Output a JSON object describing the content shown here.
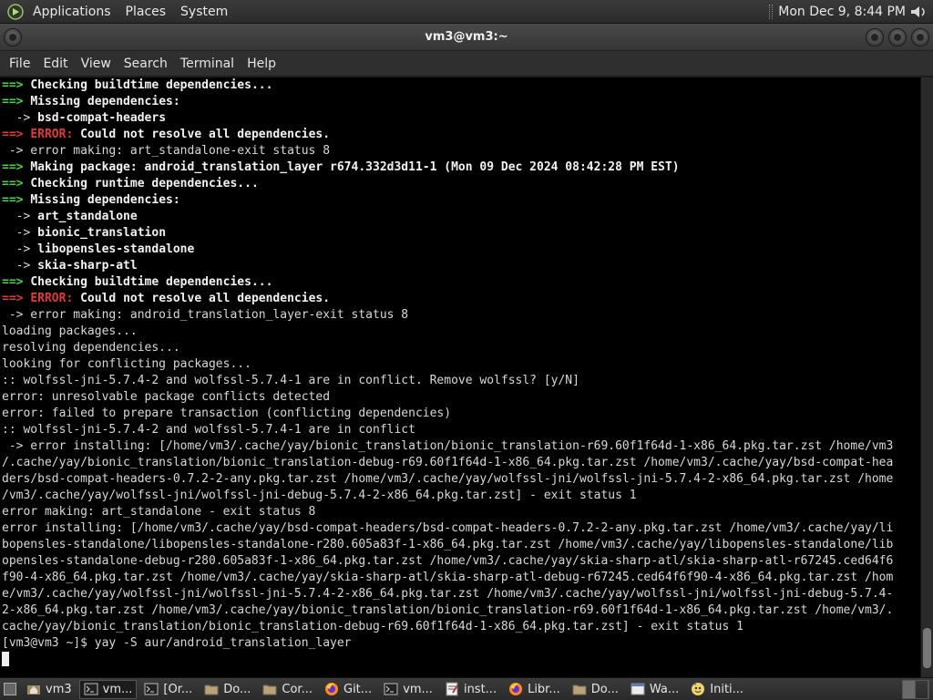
{
  "top_panel": {
    "menus": [
      "Applications",
      "Places",
      "System"
    ],
    "clock": "Mon Dec 9,  8:44 PM"
  },
  "window": {
    "title": "vm3@vm3:~"
  },
  "menubar": [
    "File",
    "Edit",
    "View",
    "Search",
    "Terminal",
    "Help"
  ],
  "terminal": {
    "lines": [
      [
        {
          "t": "==> ",
          "c": "g"
        },
        {
          "t": "Checking buildtime dependencies...",
          "c": "b"
        }
      ],
      [
        {
          "t": "==> ",
          "c": "g"
        },
        {
          "t": "Missing dependencies:",
          "c": "b"
        }
      ],
      [
        {
          "t": "  -> ",
          "c": "n"
        },
        {
          "t": "bsd-compat-headers",
          "c": "b"
        }
      ],
      [
        {
          "t": "==> ",
          "c": "r"
        },
        {
          "t": "ERROR: ",
          "c": "r"
        },
        {
          "t": "Could not resolve all dependencies.",
          "c": "b"
        }
      ],
      [
        {
          "t": " -> error making: art_standalone-exit status 8",
          "c": "n"
        }
      ],
      [
        {
          "t": "==> ",
          "c": "g"
        },
        {
          "t": "Making package: android_translation_layer r674.332d3d11-1 (Mon 09 Dec 2024 08:42:28 PM EST)",
          "c": "b"
        }
      ],
      [
        {
          "t": "==> ",
          "c": "g"
        },
        {
          "t": "Checking runtime dependencies...",
          "c": "b"
        }
      ],
      [
        {
          "t": "==> ",
          "c": "g"
        },
        {
          "t": "Missing dependencies:",
          "c": "b"
        }
      ],
      [
        {
          "t": "  -> ",
          "c": "n"
        },
        {
          "t": "art_standalone",
          "c": "b"
        }
      ],
      [
        {
          "t": "  -> ",
          "c": "n"
        },
        {
          "t": "bionic_translation",
          "c": "b"
        }
      ],
      [
        {
          "t": "  -> ",
          "c": "n"
        },
        {
          "t": "libopensles-standalone",
          "c": "b"
        }
      ],
      [
        {
          "t": "  -> ",
          "c": "n"
        },
        {
          "t": "skia-sharp-atl",
          "c": "b"
        }
      ],
      [
        {
          "t": "==> ",
          "c": "g"
        },
        {
          "t": "Checking buildtime dependencies...",
          "c": "b"
        }
      ],
      [
        {
          "t": "==> ",
          "c": "r"
        },
        {
          "t": "ERROR: ",
          "c": "r"
        },
        {
          "t": "Could not resolve all dependencies.",
          "c": "b"
        }
      ],
      [
        {
          "t": " -> error making: android_translation_layer-exit status 8",
          "c": "n"
        }
      ],
      [
        {
          "t": "loading packages...",
          "c": "n"
        }
      ],
      [
        {
          "t": "resolving dependencies...",
          "c": "n"
        }
      ],
      [
        {
          "t": "looking for conflicting packages...",
          "c": "n"
        }
      ],
      [
        {
          "t": ":: wolfssl-jni-5.7.4-2 and wolfssl-5.7.4-1 are in conflict. Remove wolfssl? [y/N]",
          "c": "n"
        }
      ],
      [
        {
          "t": "error: unresolvable package conflicts detected",
          "c": "n"
        }
      ],
      [
        {
          "t": "error: failed to prepare transaction (conflicting dependencies)",
          "c": "n"
        }
      ],
      [
        {
          "t": ":: wolfssl-jni-5.7.4-2 and wolfssl-5.7.4-1 are in conflict",
          "c": "n"
        }
      ],
      [
        {
          "t": " -> error installing: [/home/vm3/.cache/yay/bionic_translation/bionic_translation-r69.60f1f64d-1-x86_64.pkg.tar.zst /home/vm3",
          "c": "n"
        }
      ],
      [
        {
          "t": "/.cache/yay/bionic_translation/bionic_translation-debug-r69.60f1f64d-1-x86_64.pkg.tar.zst /home/vm3/.cache/yay/bsd-compat-hea",
          "c": "n"
        }
      ],
      [
        {
          "t": "ders/bsd-compat-headers-0.7.2-2-any.pkg.tar.zst /home/vm3/.cache/yay/wolfssl-jni/wolfssl-jni-5.7.4-2-x86_64.pkg.tar.zst /home",
          "c": "n"
        }
      ],
      [
        {
          "t": "/vm3/.cache/yay/wolfssl-jni/wolfssl-jni-debug-5.7.4-2-x86_64.pkg.tar.zst] - exit status 1",
          "c": "n"
        }
      ],
      [
        {
          "t": "error making: art_standalone - exit status 8",
          "c": "n"
        }
      ],
      [
        {
          "t": "error installing: [/home/vm3/.cache/yay/bsd-compat-headers/bsd-compat-headers-0.7.2-2-any.pkg.tar.zst /home/vm3/.cache/yay/li",
          "c": "n"
        }
      ],
      [
        {
          "t": "bopensles-standalone/libopensles-standalone-r280.605a83f-1-x86_64.pkg.tar.zst /home/vm3/.cache/yay/libopensles-standalone/lib",
          "c": "n"
        }
      ],
      [
        {
          "t": "opensles-standalone-debug-r280.605a83f-1-x86_64.pkg.tar.zst /home/vm3/.cache/yay/skia-sharp-atl/skia-sharp-atl-r67245.ced64f6",
          "c": "n"
        }
      ],
      [
        {
          "t": "f90-4-x86_64.pkg.tar.zst /home/vm3/.cache/yay/skia-sharp-atl/skia-sharp-atl-debug-r67245.ced64f6f90-4-x86_64.pkg.tar.zst /hom",
          "c": "n"
        }
      ],
      [
        {
          "t": "e/vm3/.cache/yay/wolfssl-jni/wolfssl-jni-5.7.4-2-x86_64.pkg.tar.zst /home/vm3/.cache/yay/wolfssl-jni/wolfssl-jni-debug-5.7.4-",
          "c": "n"
        }
      ],
      [
        {
          "t": "2-x86_64.pkg.tar.zst /home/vm3/.cache/yay/bionic_translation/bionic_translation-r69.60f1f64d-1-x86_64.pkg.tar.zst /home/vm3/.",
          "c": "n"
        }
      ],
      [
        {
          "t": "cache/yay/bionic_translation/bionic_translation-debug-r69.60f1f64d-1-x86_64.pkg.tar.zst] - exit status 1",
          "c": "n"
        }
      ],
      [
        {
          "t": "[vm3@vm3 ~]$ yay -S aur/android_translation_layer",
          "c": "n"
        }
      ]
    ]
  },
  "taskbar": {
    "tasks": [
      {
        "label": "vm3",
        "icon": "home-folder-icon"
      },
      {
        "label": "vm...",
        "icon": "terminal-icon",
        "active": true
      },
      {
        "label": "[Or...",
        "icon": "terminal-icon"
      },
      {
        "label": "Do...",
        "icon": "folder-icon"
      },
      {
        "label": "Cor...",
        "icon": "folder-icon"
      },
      {
        "label": "Git...",
        "icon": "firefox-icon"
      },
      {
        "label": "vm...",
        "icon": "terminal-icon"
      },
      {
        "label": "inst...",
        "icon": "text-editor-icon"
      },
      {
        "label": "Libr...",
        "icon": "firefox-icon"
      },
      {
        "label": "Do...",
        "icon": "folder-icon"
      },
      {
        "label": "Wa...",
        "icon": "window-icon"
      },
      {
        "label": "Initi...",
        "icon": "app-icon"
      }
    ]
  }
}
